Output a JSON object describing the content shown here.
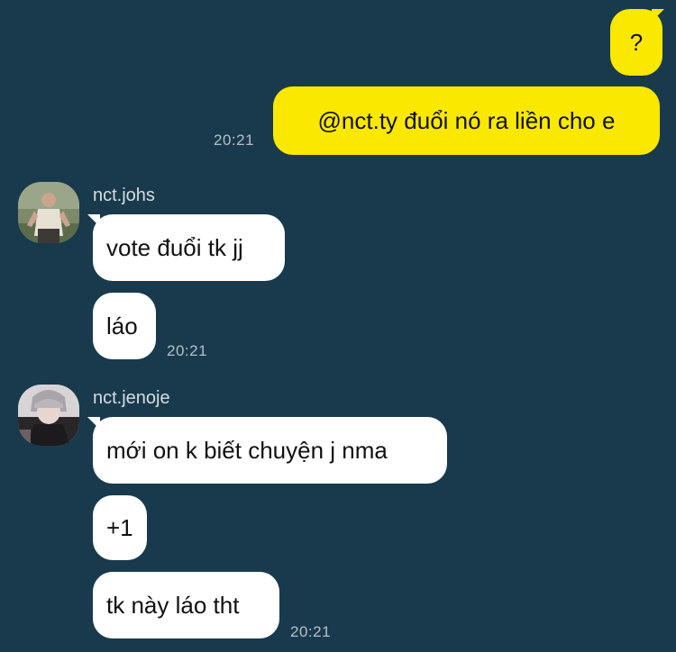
{
  "messages": {
    "out_1": "?",
    "out_2": "@nct.ty đuổi nó ra liền cho e",
    "out_2_time": "20:21",
    "johs": {
      "name": "nct.johs",
      "msg_1": "vote đuổi tk jj",
      "msg_2": "láo",
      "time": "20:21"
    },
    "jenoje": {
      "name": "nct.jenoje",
      "msg_1": "mới on k biết chuyện j nma",
      "msg_2": "+1",
      "msg_3": "tk này láo tht",
      "time": "20:21"
    }
  },
  "colors": {
    "background": "#183a4c",
    "outgoing_bubble": "#fbe800",
    "incoming_bubble": "#ffffff"
  }
}
